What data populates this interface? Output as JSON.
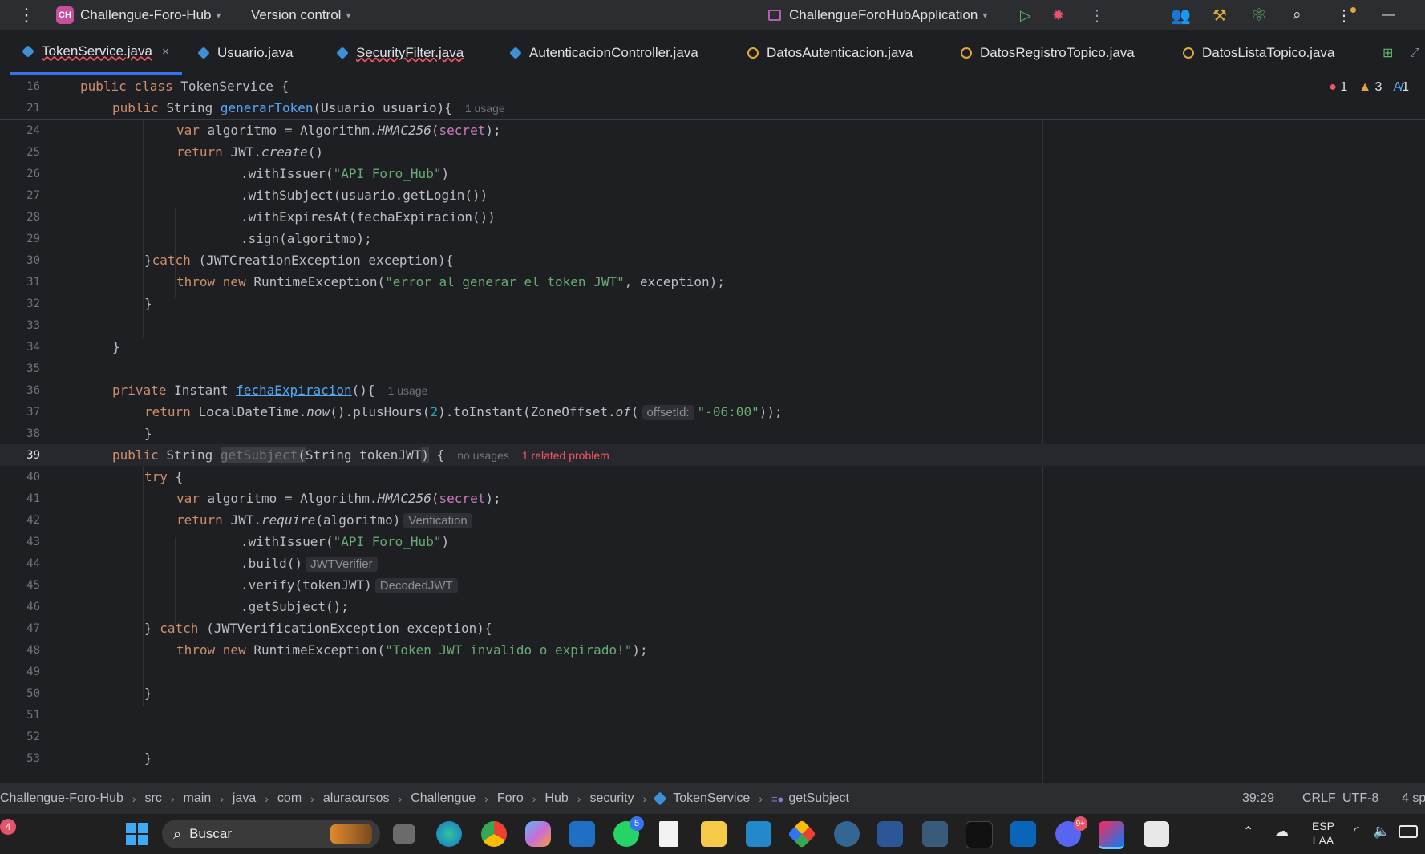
{
  "titlebar": {
    "project_initials": "CH",
    "project_name": "Challengue-Foro-Hub",
    "vcs": "Version control",
    "run_config": "ChallengueForoHubApplication"
  },
  "tabs": [
    {
      "label": "TokenService.java"
    },
    {
      "label": "Usuario.java"
    },
    {
      "label": "SecurityFilter.java"
    },
    {
      "label": "AutenticacionController.java"
    },
    {
      "label": "DatosAutenticacion.java"
    },
    {
      "label": "DatosRegistroTopico.java"
    },
    {
      "label": "DatosListaTopico.java"
    }
  ],
  "tab_close": "×",
  "inspections": {
    "errors": "1",
    "warnings": "3",
    "typos": "1"
  },
  "hints": {
    "usage1": "1 usage",
    "usage2": "1 usage",
    "no_usages": "no usages",
    "problem": "1 related problem",
    "offset_param": "offsetId:",
    "verification": "Verification",
    "jwtverifier": "JWTVerifier",
    "decodedjwt": "DecodedJWT"
  },
  "lines": [
    {
      "n": "16",
      "text": "public class TokenService {"
    },
    {
      "n": "21",
      "text": "public String generarToken(Usuario usuario){"
    },
    {
      "n": "24",
      "text": "var algoritmo = Algorithm.HMAC256(secret);"
    },
    {
      "n": "25",
      "text": "return JWT.create()"
    },
    {
      "n": "26",
      "text": ".withIssuer(\"API Foro_Hub\")"
    },
    {
      "n": "27",
      "text": ".withSubject(usuario.getLogin())"
    },
    {
      "n": "28",
      "text": ".withExpiresAt(fechaExpiracion())"
    },
    {
      "n": "29",
      "text": ".sign(algoritmo);"
    },
    {
      "n": "30",
      "text": "}catch (JWTCreationException exception){"
    },
    {
      "n": "31",
      "text": "throw new RuntimeException(\"error al generar el token JWT\", exception);"
    },
    {
      "n": "32",
      "text": "}"
    },
    {
      "n": "33",
      "text": ""
    },
    {
      "n": "34",
      "text": "}"
    },
    {
      "n": "35",
      "text": ""
    },
    {
      "n": "36",
      "text": "private Instant fechaExpiracion(){"
    },
    {
      "n": "37",
      "text": "return LocalDateTime.now().plusHours(2).toInstant(ZoneOffset.of(\"-06:00\"));"
    },
    {
      "n": "38",
      "text": "}"
    },
    {
      "n": "39",
      "text": "public String getSubject(String tokenJWT) {"
    },
    {
      "n": "40",
      "text": "try {"
    },
    {
      "n": "41",
      "text": "var algoritmo = Algorithm.HMAC256(secret);"
    },
    {
      "n": "42",
      "text": "return JWT.require(algoritmo)"
    },
    {
      "n": "43",
      "text": ".withIssuer(\"API Foro_Hub\")"
    },
    {
      "n": "44",
      "text": ".build()"
    },
    {
      "n": "45",
      "text": ".verify(tokenJWT)"
    },
    {
      "n": "46",
      "text": ".getSubject();"
    },
    {
      "n": "47",
      "text": "} catch (JWTVerificationException exception){"
    },
    {
      "n": "48",
      "text": "throw new RuntimeException(\"Token JWT invalido o expirado!\");"
    },
    {
      "n": "49",
      "text": ""
    },
    {
      "n": "50",
      "text": "}"
    },
    {
      "n": "51",
      "text": ""
    },
    {
      "n": "52",
      "text": ""
    },
    {
      "n": "53",
      "text": "}"
    }
  ],
  "breadcrumbs": [
    "Challengue-Foro-Hub",
    "src",
    "main",
    "java",
    "com",
    "aluracursos",
    "Challengue",
    "Foro",
    "Hub",
    "security",
    "TokenService",
    "getSubject"
  ],
  "status": {
    "position": "39:29",
    "line_sep": "CRLF",
    "encoding": "UTF-8",
    "indent": "4 sp"
  },
  "taskbar": {
    "search_placeholder": "Buscar",
    "widget_badge": "4",
    "whatsapp_badge": "5",
    "discord_badge": "9+",
    "lang_top": "ESP",
    "lang_bottom": "LAA"
  },
  "colors": {
    "accent": "#3574f0",
    "keyword": "#cf8e6d",
    "string": "#6aab73",
    "function": "#56a8f5",
    "error": "#f75464"
  }
}
